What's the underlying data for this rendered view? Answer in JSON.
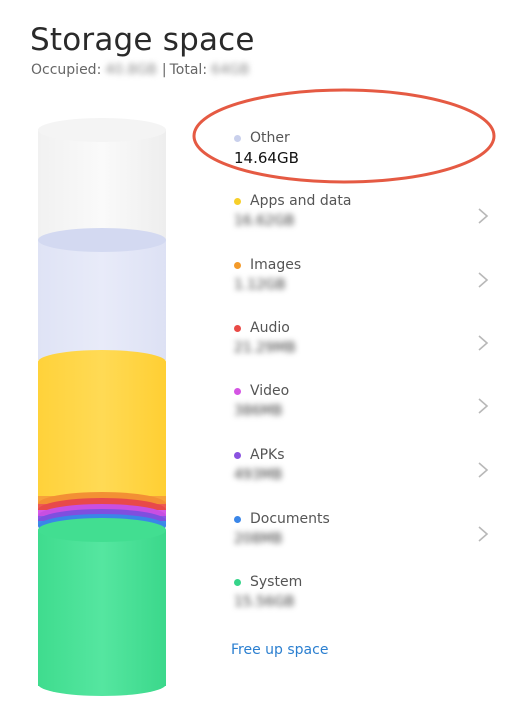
{
  "header": {
    "title": "Storage space",
    "occupied_label": "Occupied:",
    "occupied_value": "40.8GB",
    "separator": "|",
    "total_label": "Total:",
    "total_value": "64GB"
  },
  "categories": [
    {
      "label": "Other",
      "size": "14.64GB",
      "color": "#c9d0ec",
      "has_chevron": false,
      "blurred": false
    },
    {
      "label": "Apps and data",
      "size": "16.62GB",
      "color": "#f7cf2a",
      "has_chevron": true,
      "blurred": true
    },
    {
      "label": "Images",
      "size": "1.12GB",
      "color": "#f39a2a",
      "has_chevron": true,
      "blurred": true
    },
    {
      "label": "Audio",
      "size": "21.29MB",
      "color": "#e94a46",
      "has_chevron": true,
      "blurred": true
    },
    {
      "label": "Video",
      "size": "386MB",
      "color": "#d455e3",
      "has_chevron": true,
      "blurred": true
    },
    {
      "label": "APKs",
      "size": "493MB",
      "color": "#8a52e0",
      "has_chevron": true,
      "blurred": true
    },
    {
      "label": "Documents",
      "size": "208MB",
      "color": "#3a86e8",
      "has_chevron": true,
      "blurred": true
    },
    {
      "label": "System",
      "size": "15.56GB",
      "color": "#36d48a",
      "has_chevron": false,
      "blurred": true
    }
  ],
  "actions": {
    "free_up_label": "Free up space"
  },
  "annotation": {
    "highlight_color": "#e55a43"
  },
  "icons": {
    "chevron": "chevron-right-icon",
    "dot": "color-dot-icon"
  }
}
